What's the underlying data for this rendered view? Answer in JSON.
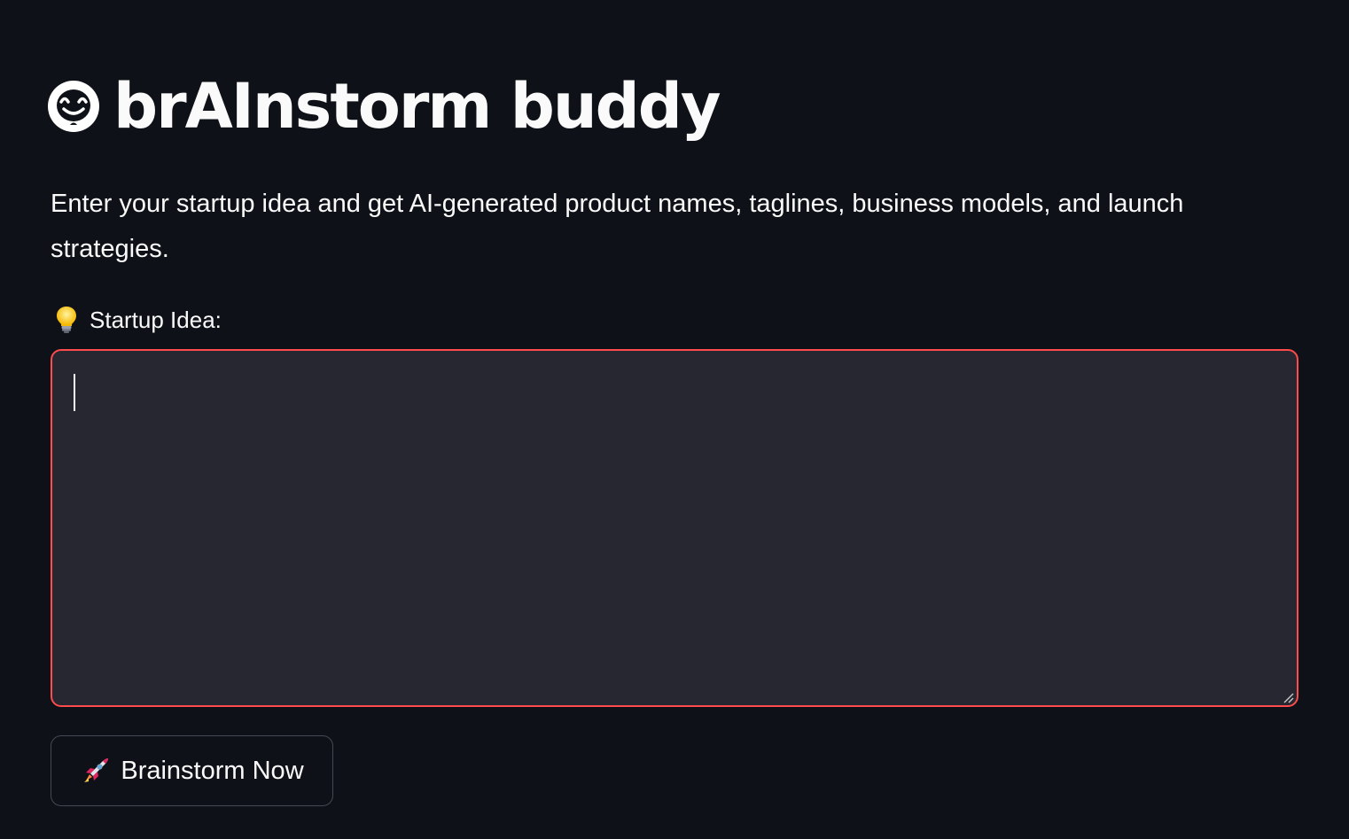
{
  "app": {
    "title": "brAInstorm buddy",
    "title_icon": "robot-face-icon",
    "description": "Enter your startup idea and get AI-generated product names, taglines, business models, and launch strategies."
  },
  "form": {
    "idea_label": "Startup Idea:",
    "idea_label_icon": "light-bulb-icon",
    "idea_value": "",
    "idea_placeholder": "",
    "submit_label": "Brainstorm Now",
    "submit_icon": "rocket-icon"
  },
  "colors": {
    "background": "#0e1117",
    "input_background": "#262730",
    "focus_border": "#ff4b4b",
    "text": "#fafafa",
    "button_border": "#464955"
  }
}
